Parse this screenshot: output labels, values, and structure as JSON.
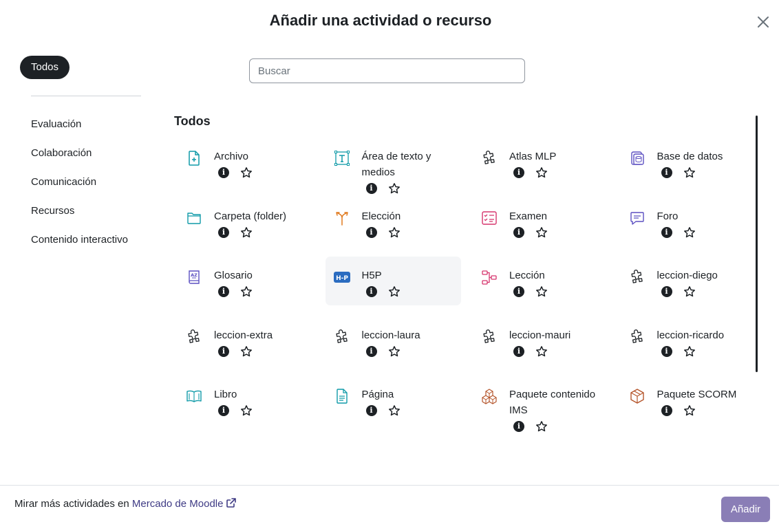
{
  "modal": {
    "title": "Añadir una actividad o recurso"
  },
  "sidebar": {
    "active": "Todos",
    "items": [
      {
        "label": "Evaluación"
      },
      {
        "label": "Colaboración"
      },
      {
        "label": "Comunicación"
      },
      {
        "label": "Recursos"
      },
      {
        "label": "Contenido interactivo"
      }
    ]
  },
  "search": {
    "placeholder": "Buscar"
  },
  "section": {
    "title": "Todos"
  },
  "activities": [
    {
      "name": "Archivo",
      "icon": "file-add-icon",
      "color": "#0f9aa8"
    },
    {
      "name": "Área de texto y medios",
      "icon": "text-frame-icon",
      "color": "#0f9aa8"
    },
    {
      "name": "Atlas MLP",
      "icon": "puzzle-icon",
      "color": "#1d2125"
    },
    {
      "name": "Base de datos",
      "icon": "database-icon",
      "color": "#5b4fc1"
    },
    {
      "name": "Carpeta (folder)",
      "icon": "folder-icon",
      "color": "#0f9aa8"
    },
    {
      "name": "Elección",
      "icon": "choice-icon",
      "color": "#e07a1f"
    },
    {
      "name": "Examen",
      "icon": "quiz-icon",
      "color": "#d6336c"
    },
    {
      "name": "Foro",
      "icon": "forum-icon",
      "color": "#5b4fc1"
    },
    {
      "name": "Glosario",
      "icon": "glossary-icon",
      "color": "#5b4fc1"
    },
    {
      "name": "H5P",
      "icon": "h5p-icon",
      "color": "#2b6cc0"
    },
    {
      "name": "Lección",
      "icon": "lesson-icon",
      "color": "#d6336c"
    },
    {
      "name": "leccion-diego",
      "icon": "puzzle-icon",
      "color": "#1d2125"
    },
    {
      "name": "leccion-extra",
      "icon": "puzzle-icon",
      "color": "#1d2125"
    },
    {
      "name": "leccion-laura",
      "icon": "puzzle-icon",
      "color": "#1d2125"
    },
    {
      "name": "leccion-mauri",
      "icon": "puzzle-icon",
      "color": "#1d2125"
    },
    {
      "name": "leccion-ricardo",
      "icon": "puzzle-icon",
      "color": "#1d2125"
    },
    {
      "name": "Libro",
      "icon": "book-icon",
      "color": "#0f9aa8"
    },
    {
      "name": "Página",
      "icon": "page-icon",
      "color": "#0f9aa8"
    },
    {
      "name": "Paquete contenido IMS",
      "icon": "package-icon",
      "color": "#b5552b"
    },
    {
      "name": "Paquete SCORM",
      "icon": "scorm-icon",
      "color": "#b5552b"
    }
  ],
  "footer": {
    "prefix": "Mirar más actividades en ",
    "link": "Mercado de Moodle",
    "add_button": "Añadir"
  }
}
